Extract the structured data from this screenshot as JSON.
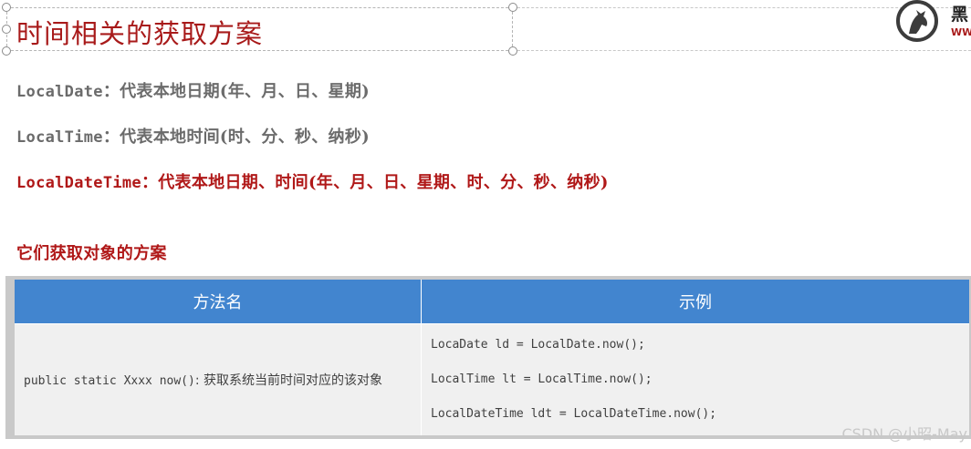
{
  "slide": {
    "title": "时间相关的获取方案",
    "lines": [
      {
        "code": "LocalDate",
        "text": "：代表本地日期(年、月、日、星期)"
      },
      {
        "code": "LocalTime",
        "text": "：代表本地时间(时、分、秒、纳秒)"
      },
      {
        "code": "LocalDateTime",
        "text": "：代表本地日期、时间(年、月、日、星期、时、分、秒、纳秒)"
      }
    ],
    "subheading": "它们获取对象的方案"
  },
  "logo": {
    "text": "黑",
    "sub": "WW",
    "icon": "horse-logo-icon"
  },
  "table": {
    "headers": [
      "方法名",
      "示例"
    ],
    "method_code": "public static Xxxx now()",
    "method_text": ": 获取系统当前时间对应的该对象",
    "examples": [
      "LocaDate ld = LocalDate.now();",
      "LocalTime lt = LocalTime.now();",
      "LocalDateTime ldt = LocalDateTime.now();"
    ]
  },
  "watermark": "CSDN @小昭-May",
  "colors": {
    "title_red": "#a81a1a",
    "header_blue": "#4285cf",
    "gray_text": "#6b6b6b"
  }
}
